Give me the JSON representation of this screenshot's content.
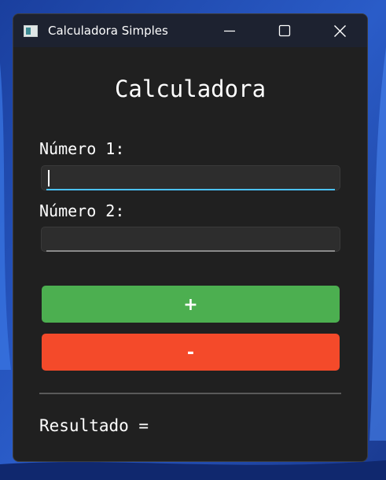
{
  "window": {
    "title": "Calculadora Simples",
    "app_icon": "calculator-app-icon",
    "controls": {
      "minimize": "minimize-icon",
      "maximize": "maximize-icon",
      "close": "close-icon"
    }
  },
  "main": {
    "heading": "Calculadora",
    "field1": {
      "label": "Número 1:",
      "value": "",
      "placeholder": ""
    },
    "field2": {
      "label": "Número 2:",
      "value": "",
      "placeholder": ""
    },
    "buttons": {
      "add_label": "+",
      "subtract_label": "-"
    },
    "result_label": "Resultado ="
  },
  "colors": {
    "window_bg": "#202020",
    "titlebar_bg": "#1d2230",
    "add_button": "#4caf50",
    "subtract_button": "#f44a2a",
    "focus_underline": "#4cc2ff"
  }
}
